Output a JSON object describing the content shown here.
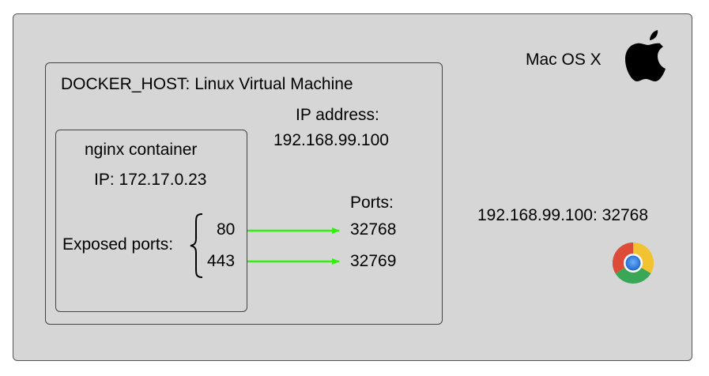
{
  "host": {
    "os_label": "Mac OS X",
    "os_logo": "apple-logo",
    "browser_url": "192.168.99.100: 32768",
    "browser_icon": "chrome-icon"
  },
  "vm": {
    "title": "DOCKER_HOST: Linux Virtual Machine",
    "ip_label": "IP address:",
    "ip_value": "192.168.99.100",
    "ports_label": "Ports:",
    "host_ports": [
      "32768",
      "32769"
    ]
  },
  "container": {
    "title": "nginx container",
    "ip": "IP: 172.17.0.23",
    "exposed_label": "Exposed ports:",
    "ports": [
      "80",
      "443"
    ]
  },
  "colors": {
    "arrow": "#33ee11",
    "background": "#d6d6d6"
  }
}
